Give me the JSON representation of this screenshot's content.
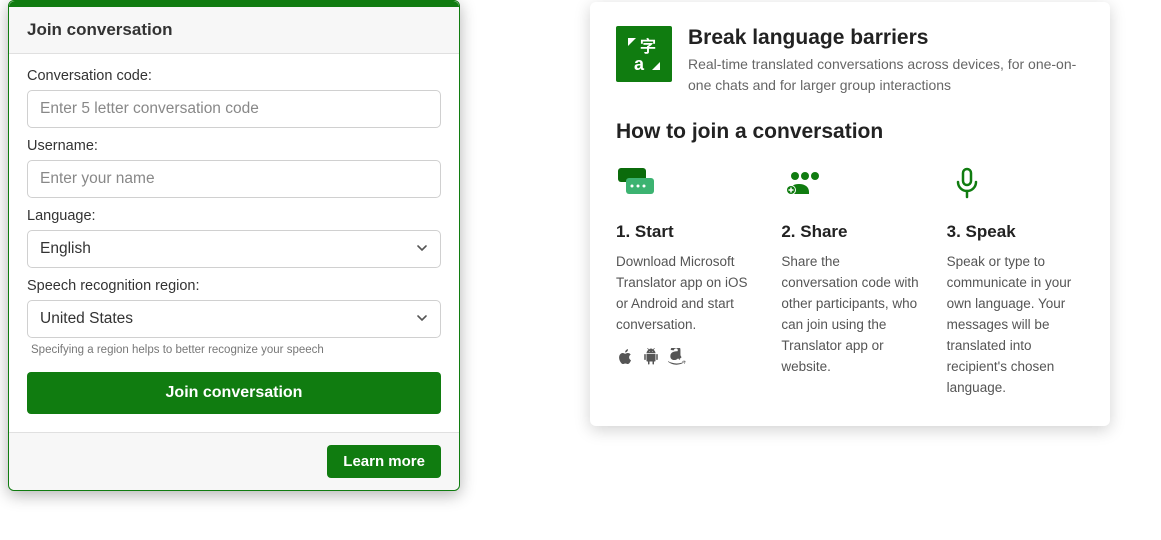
{
  "form": {
    "title": "Join conversation",
    "code_label": "Conversation code:",
    "code_placeholder": "Enter 5 letter conversation code",
    "username_label": "Username:",
    "username_placeholder": "Enter your name",
    "language_label": "Language:",
    "language_value": "English",
    "region_label": "Speech recognition region:",
    "region_value": "United States",
    "region_helper": "Specifying a region helps to better recognize your speech",
    "join_button": "Join conversation",
    "learn_more": "Learn more"
  },
  "info": {
    "hero_title": "Break language barriers",
    "hero_desc": "Real-time translated conversations across devices, for one-on-one chats and for larger group interactions",
    "howto_title": "How to join a conversation",
    "steps": [
      {
        "title": "1. Start",
        "desc": "Download Microsoft Translator app on iOS or Android and start conversation."
      },
      {
        "title": "2. Share",
        "desc": "Share the conversation code with other participants, who can join using the Translator app or website."
      },
      {
        "title": "3. Speak",
        "desc": "Speak or type to communicate in your own language. Your messages will be translated into recipient's chosen language."
      }
    ]
  }
}
